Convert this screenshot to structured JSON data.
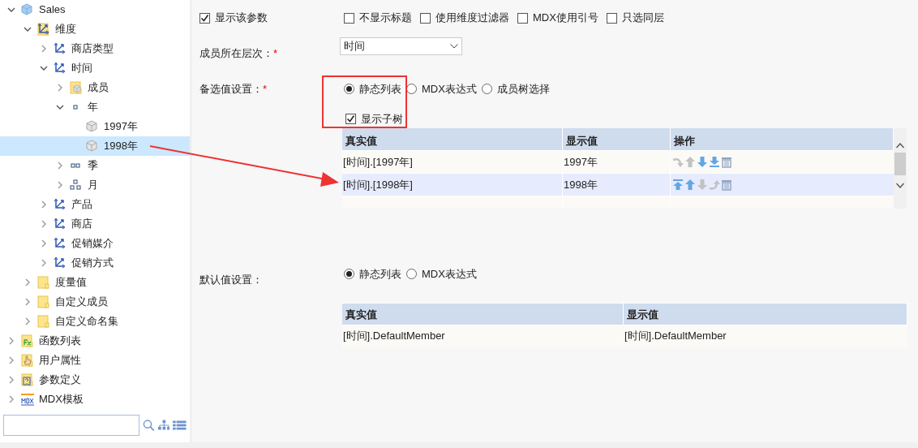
{
  "tree": [
    {
      "label": "Sales",
      "kind": "cube",
      "expanded": true,
      "selected": false,
      "children": [
        {
          "label": "维度",
          "kind": "dim-folder",
          "expanded": true,
          "selected": false,
          "children": [
            {
              "label": "商店类型",
              "kind": "dimension",
              "expanded": false,
              "selected": false
            },
            {
              "label": "时间",
              "kind": "dimension",
              "expanded": true,
              "selected": false,
              "children": [
                {
                  "label": "成员",
                  "kind": "member-folder",
                  "expanded": false,
                  "selected": false
                },
                {
                  "label": "年",
                  "kind": "level1",
                  "expanded": true,
                  "selected": false,
                  "children": [
                    {
                      "label": "1997年",
                      "kind": "member",
                      "selected": false
                    },
                    {
                      "label": "1998年",
                      "kind": "member",
                      "selected": true
                    }
                  ]
                },
                {
                  "label": "季",
                  "kind": "level2",
                  "expanded": false,
                  "selected": false
                },
                {
                  "label": "月",
                  "kind": "level3",
                  "expanded": false,
                  "selected": false
                }
              ]
            },
            {
              "label": "产品",
              "kind": "dimension",
              "expanded": false,
              "selected": false
            },
            {
              "label": "商店",
              "kind": "dimension",
              "expanded": false,
              "selected": false
            },
            {
              "label": "促销媒介",
              "kind": "dimension",
              "expanded": false,
              "selected": false
            },
            {
              "label": "促销方式",
              "kind": "dimension",
              "expanded": false,
              "selected": false
            }
          ]
        },
        {
          "label": "度量值",
          "kind": "folder",
          "expanded": false,
          "selected": false
        },
        {
          "label": "自定义成员",
          "kind": "folder",
          "expanded": false,
          "selected": false
        },
        {
          "label": "自定义命名集",
          "kind": "folder",
          "expanded": false,
          "selected": false
        }
      ]
    },
    {
      "label": "函数列表",
      "kind": "fx-folder",
      "expanded": false,
      "selected": false
    },
    {
      "label": "用户属性",
      "kind": "hand-folder",
      "expanded": false,
      "selected": false
    },
    {
      "label": "参数定义",
      "kind": "param-folder",
      "expanded": false,
      "selected": false
    },
    {
      "label": "MDX模板",
      "kind": "mdx",
      "expanded": false,
      "selected": false
    }
  ],
  "options": [
    {
      "label": "显示该参数",
      "checked": true
    },
    {
      "label": "不显示标题",
      "checked": false
    },
    {
      "label": "使用维度过滤器",
      "checked": false
    },
    {
      "label": "MDX使用引号",
      "checked": false
    },
    {
      "label": "只选同层",
      "checked": false
    }
  ],
  "level_field": {
    "label": "成员所在层次：",
    "required_mark": "*",
    "value": "时间"
  },
  "candidates": {
    "label": "备选值设置：",
    "required_mark": "*",
    "radios": [
      {
        "label": "静态列表",
        "selected": true
      },
      {
        "label": "MDX表达式",
        "selected": false
      },
      {
        "label": "成员树选择",
        "selected": false
      }
    ],
    "show_subtree": {
      "label": "显示子树",
      "checked": true
    },
    "columns": [
      "真实值",
      "显示值",
      "操作"
    ],
    "rows": [
      {
        "real": "[时间].[1997年]",
        "display": "1997年",
        "selected": false,
        "actions": [
          {
            "kind": "turn-down",
            "enabled": false
          },
          {
            "kind": "up",
            "enabled": false
          },
          {
            "kind": "down",
            "enabled": true
          },
          {
            "kind": "bottom",
            "enabled": true
          },
          {
            "kind": "delete",
            "enabled": true
          }
        ]
      },
      {
        "real": "[时间].[1998年]",
        "display": "1998年",
        "selected": true,
        "actions": [
          {
            "kind": "top",
            "enabled": true
          },
          {
            "kind": "up",
            "enabled": true
          },
          {
            "kind": "down",
            "enabled": false
          },
          {
            "kind": "turn-up",
            "enabled": false
          },
          {
            "kind": "delete",
            "enabled": true
          }
        ]
      }
    ]
  },
  "defaults": {
    "label": "默认值设置：",
    "radios": [
      {
        "label": "静态列表",
        "selected": true
      },
      {
        "label": "MDX表达式",
        "selected": false
      }
    ],
    "columns": [
      "真实值",
      "显示值"
    ],
    "rows": [
      {
        "real": "[时间].DefaultMember",
        "display": "[时间].DefaultMember"
      }
    ]
  }
}
